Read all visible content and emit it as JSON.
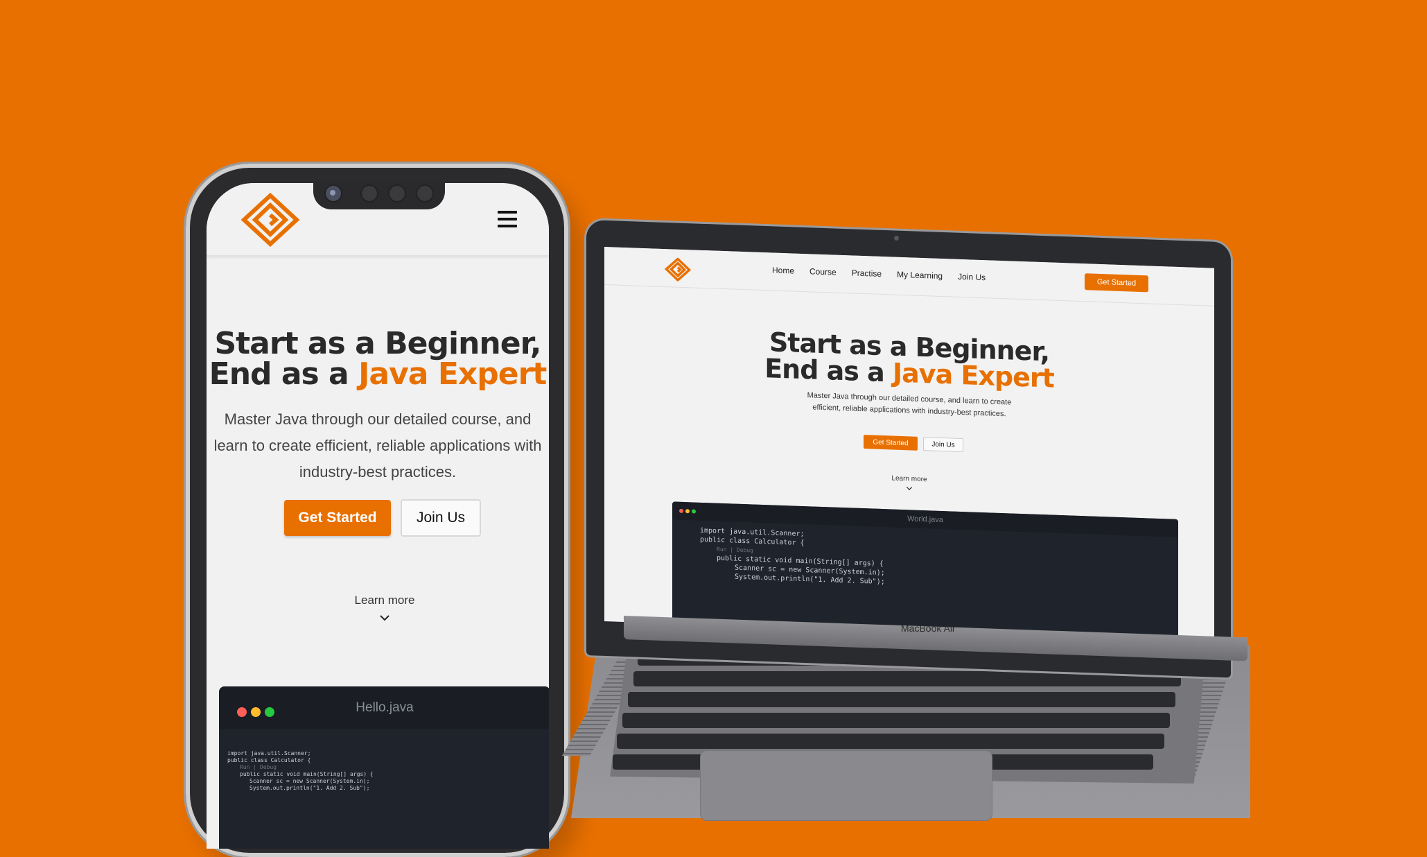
{
  "brand": {
    "accent": "#E87000",
    "background": "#E87000"
  },
  "phone": {
    "menu_icon": "hamburger-icon",
    "hero": {
      "title_line1": "Start as a Beginner,",
      "title_line2_prefix": "End as a ",
      "title_line2_accent": "Java Expert",
      "description": "Master Java through our detailed course, and learn to create efficient, reliable applications with industry-best practices.",
      "primary_button": "Get Started",
      "secondary_button": "Join Us",
      "learn_more": "Learn more"
    },
    "code_window": {
      "title": "Hello.java"
    }
  },
  "laptop": {
    "model_label": "MacBook Air",
    "nav": {
      "links": [
        "Home",
        "Course",
        "Practise",
        "My Learning",
        "Join Us"
      ],
      "cta": "Get Started"
    },
    "hero": {
      "title_line1": "Start as a Beginner,",
      "title_line2_prefix": "End as a ",
      "title_line2_accent": "Java Expert",
      "description": "Master Java through our detailed course, and learn to create efficient, reliable applications with industry-best practices.",
      "primary_button": "Get Started",
      "secondary_button": "Join Us",
      "learn_more": "Learn more"
    },
    "code_window": {
      "title": "World.java"
    }
  },
  "code_lines": [
    "import java.util.Scanner;",
    "",
    "public class Calculator {",
    "Run | Debug",
    "public static void main(String[] args) {",
    "Scanner sc = new Scanner(System.in);",
    "System.out.println(\"1. Add 2. Sub\");"
  ]
}
